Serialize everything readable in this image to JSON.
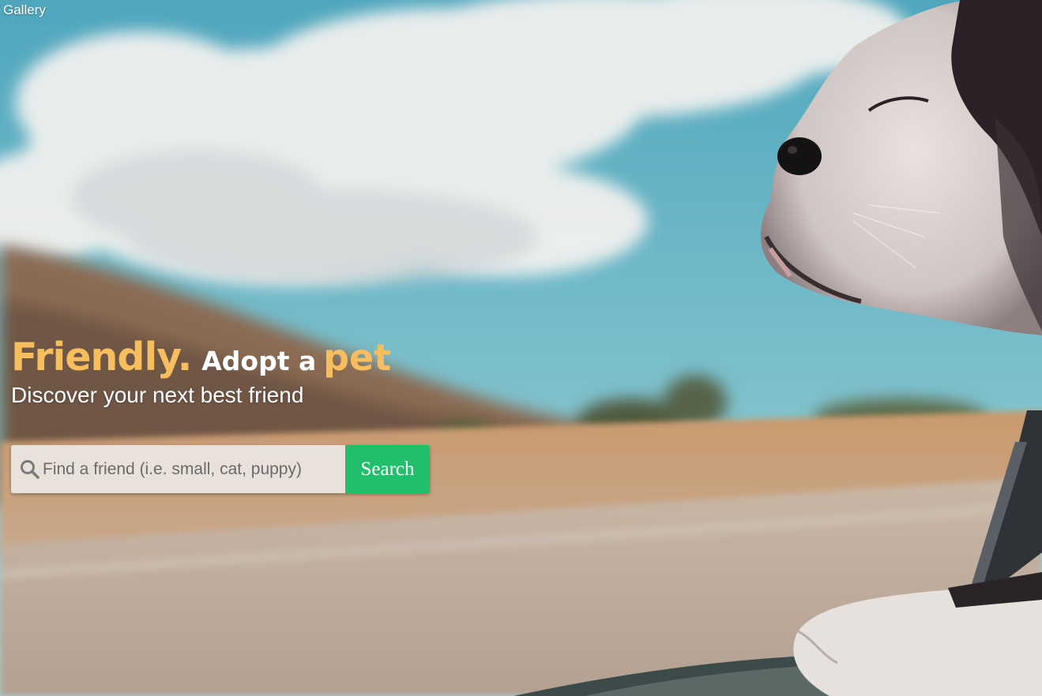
{
  "nav": {
    "gallery_label": "Gallery"
  },
  "hero": {
    "headline_friendly": "Friendly.",
    "headline_adopt": "Adopt a",
    "headline_pet": "pet",
    "subheadline": "Discover your next best friend"
  },
  "search": {
    "placeholder": "Find a friend (i.e. small, cat, puppy)",
    "value": "",
    "button_label": "Search",
    "icon": "search-icon"
  },
  "colors": {
    "accent_orange": "#f6be5e",
    "button_green": "#21bf6c",
    "text_white": "#ffffff"
  }
}
